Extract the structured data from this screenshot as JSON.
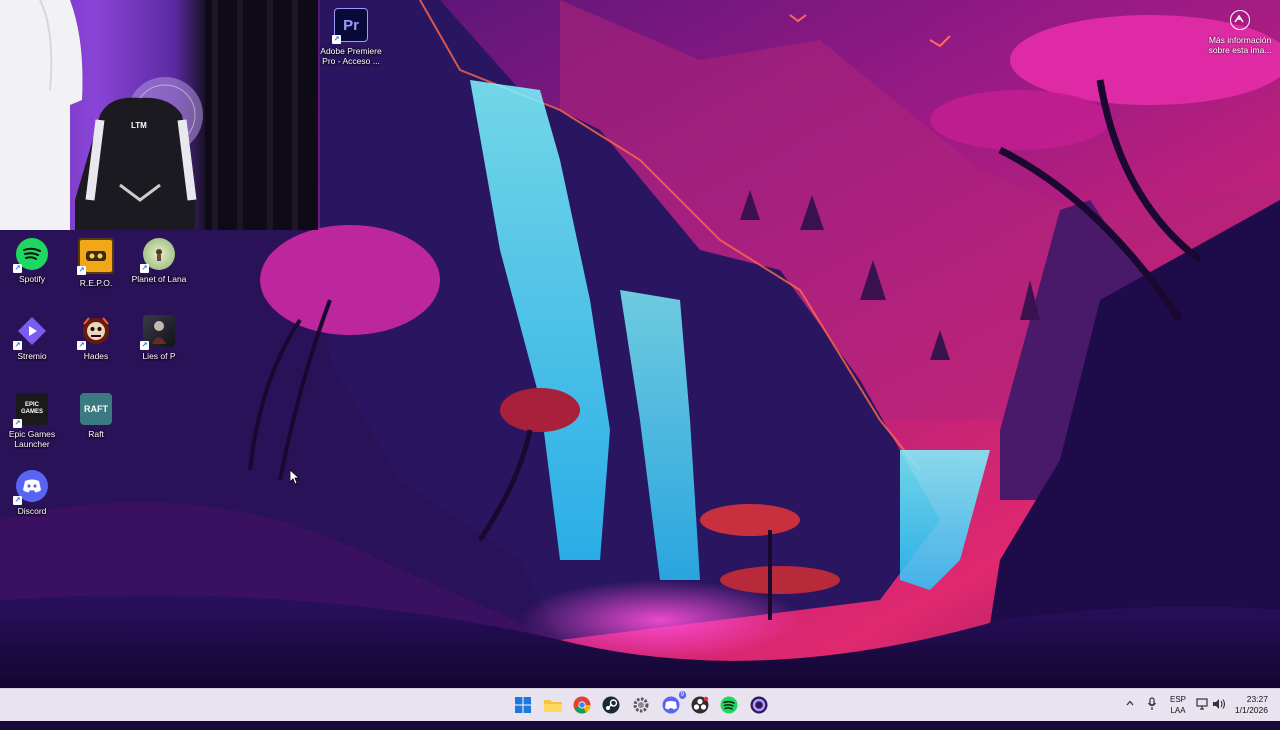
{
  "desktop": {
    "icons": [
      {
        "label": "Adobe Premiere Pro - Acceso ...",
        "icon": "premiere-icon",
        "icon_text": "Pr"
      },
      {
        "label": "Spotify",
        "icon": "spotify-icon"
      },
      {
        "label": "R.E.P.O.",
        "icon": "repo-icon"
      },
      {
        "label": "Planet of Lana",
        "icon": "planet-of-lana-icon"
      },
      {
        "label": "Stremio",
        "icon": "stremio-icon"
      },
      {
        "label": "Hades",
        "icon": "hades-icon"
      },
      {
        "label": "Lies of P",
        "icon": "lies-of-p-icon"
      },
      {
        "label": "Epic Games Launcher",
        "icon": "epic-games-icon",
        "icon_text": "EPIC GAMES"
      },
      {
        "label": "Raft",
        "icon": "raft-icon",
        "icon_text": "RAFT"
      },
      {
        "label": "Discord",
        "icon": "discord-icon"
      }
    ],
    "info_label": "Más información sobre esta ima..."
  },
  "webcam": {
    "chair_text": "LTM"
  },
  "taskbar": {
    "apps": [
      "windows-start-icon",
      "file-explorer-icon",
      "chrome-icon",
      "steam-icon",
      "settings-icon",
      "discord-icon",
      "obs-icon",
      "spotify-icon",
      "cortana-icon"
    ],
    "discord_badge": "9",
    "language": {
      "line1": "ESP",
      "line2": "LAA"
    },
    "time": "23:27",
    "date": "1/1/2026"
  },
  "colors": {
    "taskbar_bg": "#e9e3ef",
    "wallpaper_sky": "#8a1a7a",
    "waterfall": "#3ff0ff"
  }
}
